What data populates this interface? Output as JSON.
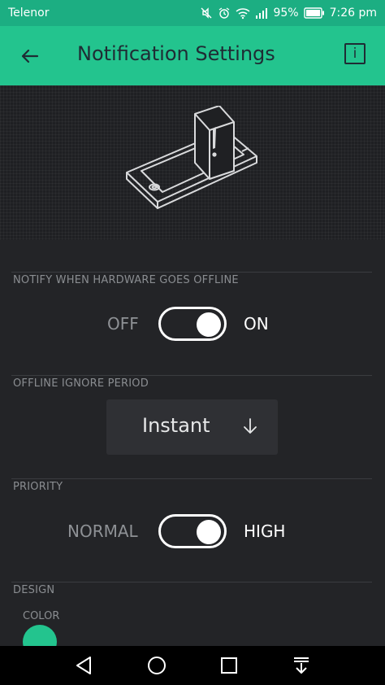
{
  "status_bar": {
    "carrier": "Telenor",
    "battery_percent": "95%",
    "time": "7:26 pm",
    "icons": [
      "mute-icon",
      "alarm-icon",
      "wifi-icon",
      "signal-icon",
      "battery-icon"
    ]
  },
  "app_bar": {
    "title": "Notification Settings",
    "info_label": "i",
    "color": "#23c48e"
  },
  "sections": {
    "offline_notify": {
      "label": "NOTIFY WHEN HARDWARE GOES OFFLINE",
      "off_label": "OFF",
      "on_label": "ON",
      "enabled": true
    },
    "ignore_period": {
      "label": "OFFLINE IGNORE PERIOD",
      "value": "Instant"
    },
    "priority": {
      "label": "PRIORITY",
      "off_label": "NORMAL",
      "on_label": "HIGH",
      "high": true
    },
    "design": {
      "label": "DESIGN",
      "color_label": "COLOR",
      "color": "#23c48e"
    }
  },
  "nav_bar": {
    "buttons": [
      "back-triangle-icon",
      "home-circle-icon",
      "recents-square-icon",
      "notifications-pulldown-icon"
    ]
  }
}
